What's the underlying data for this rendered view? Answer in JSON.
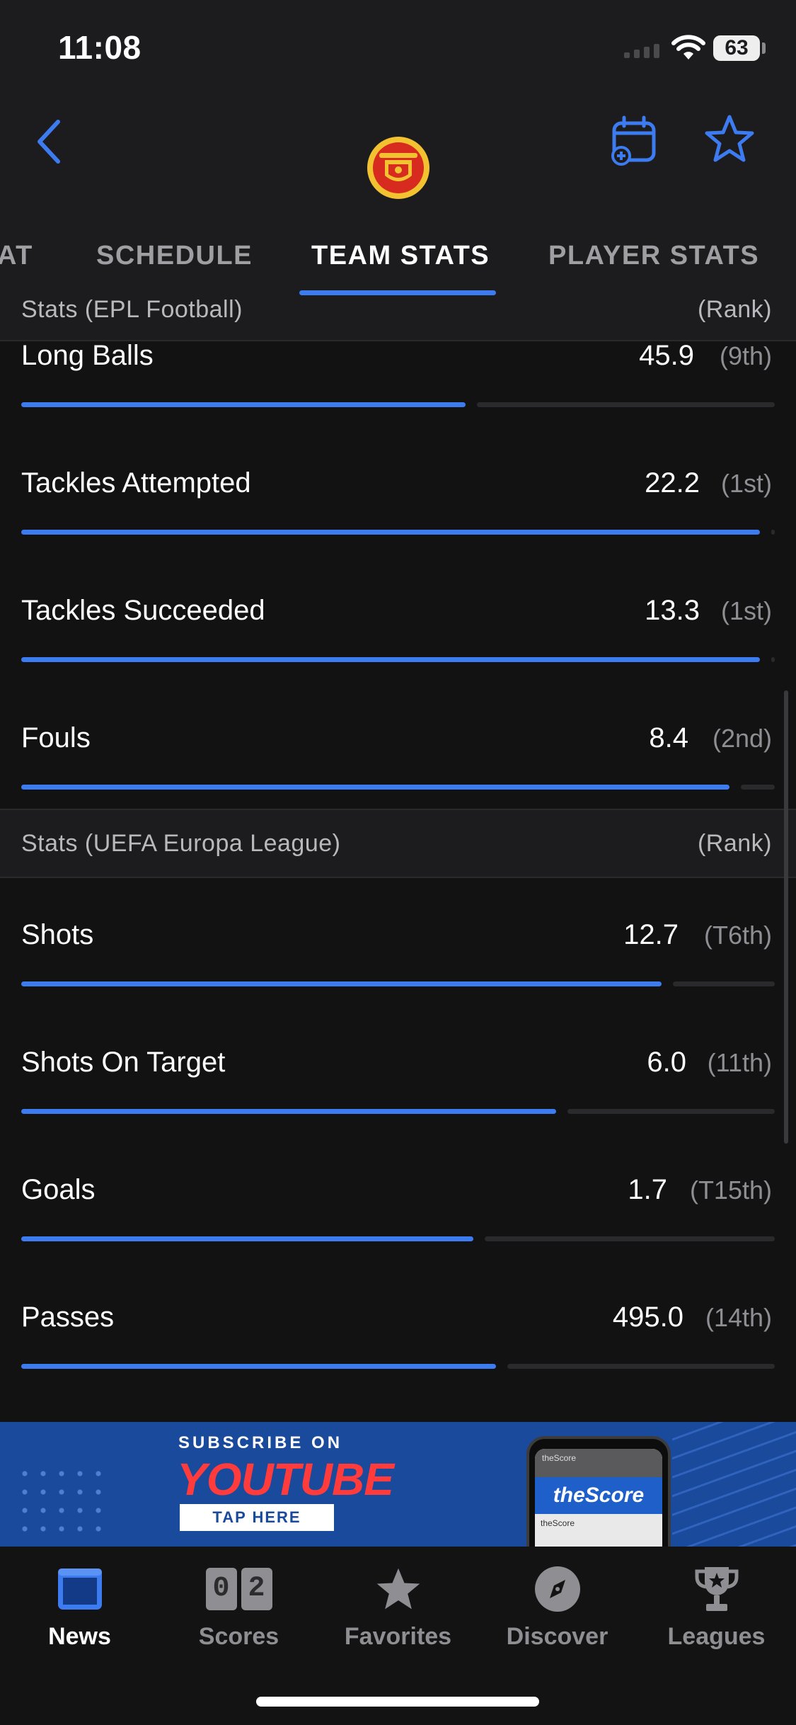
{
  "status_bar": {
    "time": "11:08",
    "battery": "63"
  },
  "header": {
    "icons": {
      "back": "chevron-left-icon",
      "calendar": "calendar-add-icon",
      "favorite": "star-outline-icon",
      "team": "manchester-united-crest"
    },
    "accent_color": "#3d7bf0"
  },
  "tabs": [
    {
      "label": "AT",
      "active": false
    },
    {
      "label": "SCHEDULE",
      "active": false
    },
    {
      "label": "TEAM STATS",
      "active": true
    },
    {
      "label": "PLAYER STATS",
      "active": false
    }
  ],
  "sections": {
    "epl": {
      "title": "Stats (EPL Football)",
      "rank_label": "(Rank)"
    },
    "uefa": {
      "title": "Stats (UEFA Europa League)",
      "rank_label": "(Rank)"
    }
  },
  "stats": [
    {
      "label": "Long Balls",
      "value": "45.9",
      "rank": "(9th)",
      "fill": 0.59
    },
    {
      "label": "Tackles Attempted",
      "value": "22.2",
      "rank": "(1st)",
      "fill": 0.98
    },
    {
      "label": "Tackles Succeeded",
      "value": "13.3",
      "rank": "(1st)",
      "fill": 0.98
    },
    {
      "label": "Fouls",
      "value": "8.4",
      "rank": "(2nd)",
      "fill": 0.94
    },
    {
      "label": "Shots",
      "value": "12.7",
      "rank": "(T6th)",
      "fill": 0.85
    },
    {
      "label": "Shots On Target",
      "value": "6.0",
      "rank": "(11th)",
      "fill": 0.71
    },
    {
      "label": "Goals",
      "value": "1.7",
      "rank": "(T15th)",
      "fill": 0.6
    },
    {
      "label": "Passes",
      "value": "495.0",
      "rank": "(14th)",
      "fill": 0.63
    }
  ],
  "ad": {
    "subscribe": "SUBSCRIBE ON",
    "youtube": "YOUTUBE",
    "tap": "TAP HERE",
    "brand": "theScore",
    "phone_bar": "theScore",
    "phone_row": "theScore"
  },
  "bottom_nav": [
    {
      "label": "News",
      "icon": "news-icon",
      "active": true
    },
    {
      "label": "Scores",
      "icon": "scores-icon",
      "active": false,
      "digits": [
        "0",
        "2"
      ]
    },
    {
      "label": "Favorites",
      "icon": "star-filled-icon",
      "active": false
    },
    {
      "label": "Discover",
      "icon": "compass-icon",
      "active": false
    },
    {
      "label": "Leagues",
      "icon": "trophy-icon",
      "active": false
    }
  ]
}
